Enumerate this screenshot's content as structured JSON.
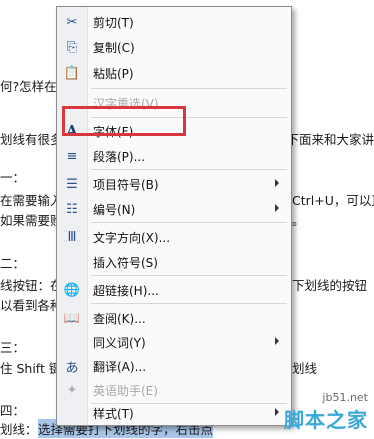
{
  "document": {
    "lines": [
      "何?怎样在 W",
      "划线有很多",
      "一：",
      "在需要输入",
      "如果需要购",
      "二：",
      "线按钮：在",
      "以看到各种",
      "三：",
      "住 Shift 键",
      "四：",
      "划线：",
      "选择需要打下划线的字，右击点"
    ],
    "right_fragments": [
      "下面来和大家讲",
      "Ctrl+U，可以直",
      "。",
      "下划线的按钮",
      "划线"
    ]
  },
  "menu": {
    "items": [
      {
        "label": "剪切(T)",
        "icon": "scissors-icon",
        "glyph": "✂",
        "disabled": false,
        "submenu": false
      },
      {
        "label": "复制(C)",
        "icon": "copy-icon",
        "glyph": "⎘",
        "disabled": false,
        "submenu": false
      },
      {
        "label": "粘贴(P)",
        "icon": "paste-icon",
        "glyph": "📋",
        "disabled": false,
        "submenu": false
      },
      {
        "label": "汉字重选(V)",
        "icon": "",
        "glyph": "",
        "disabled": true,
        "submenu": false
      },
      {
        "label": "字体(F)...",
        "icon": "font-icon",
        "glyph": "A",
        "disabled": false,
        "submenu": false
      },
      {
        "label": "段落(P)...",
        "icon": "paragraph-icon",
        "glyph": "≡",
        "disabled": false,
        "submenu": false
      },
      {
        "label": "项目符号(B)",
        "icon": "bullets-icon",
        "glyph": "☰",
        "disabled": false,
        "submenu": true
      },
      {
        "label": "编号(N)",
        "icon": "numbering-icon",
        "glyph": "☷",
        "disabled": false,
        "submenu": true
      },
      {
        "label": "文字方向(X)...",
        "icon": "text-direction-icon",
        "glyph": "Ⅲ",
        "disabled": false,
        "submenu": false
      },
      {
        "label": "插入符号(S)",
        "icon": "",
        "glyph": "",
        "disabled": false,
        "submenu": false
      },
      {
        "label": "超链接(H)...",
        "icon": "hyperlink-icon",
        "glyph": "🌐",
        "disabled": false,
        "submenu": false
      },
      {
        "label": "查阅(K)...",
        "icon": "lookup-icon",
        "glyph": "📖",
        "disabled": false,
        "submenu": false
      },
      {
        "label": "同义词(Y)",
        "icon": "",
        "glyph": "",
        "disabled": false,
        "submenu": true
      },
      {
        "label": "翻译(A)...",
        "icon": "translate-icon",
        "glyph": "あ",
        "disabled": false,
        "submenu": false
      },
      {
        "label": "英语助手(E)",
        "icon": "english-assistant-icon",
        "glyph": "✦",
        "disabled": true,
        "submenu": false
      },
      {
        "label": "样式(T)",
        "icon": "",
        "glyph": "",
        "disabled": false,
        "submenu": true
      }
    ]
  },
  "watermark": {
    "url": "jb51.net",
    "brand": "脚本之家"
  },
  "colors": {
    "highlight_box": "#d9363e",
    "selection": "#a9c6ea",
    "menu_bg": "#fafafa",
    "gutter_bg": "#eef0f3"
  }
}
